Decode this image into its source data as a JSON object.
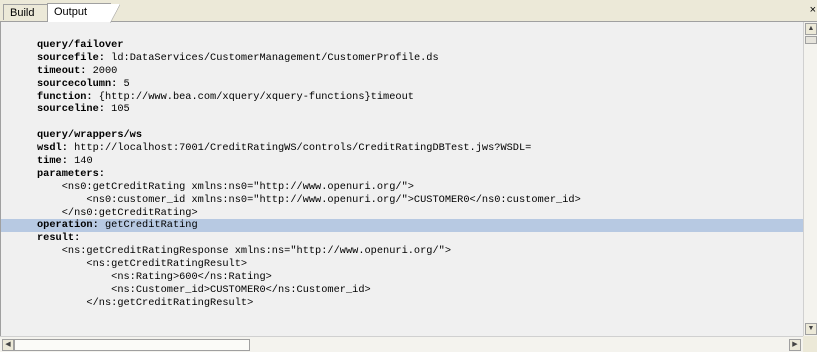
{
  "tabs": [
    {
      "label": "Build",
      "active": false
    },
    {
      "label": "Output",
      "active": true
    }
  ],
  "close_label": "×",
  "output": {
    "lines": [
      {
        "key": "query/failover",
        "value": ""
      },
      {
        "key": "sourcefile:",
        "value": " ld:DataServices/CustomerManagement/CustomerProfile.ds"
      },
      {
        "key": "timeout:",
        "value": " 2000"
      },
      {
        "key": "sourcecolumn:",
        "value": " 5"
      },
      {
        "key": "function:",
        "value": " {http://www.bea.com/xquery/xquery-functions}timeout"
      },
      {
        "key": "sourceline:",
        "value": " 105"
      },
      {
        "key": "",
        "value": ""
      },
      {
        "key": "query/wrappers/ws",
        "value": ""
      },
      {
        "key": "wsdl:",
        "value": " http://localhost:7001/CreditRatingWS/controls/CreditRatingDBTest.jws?WSDL="
      },
      {
        "key": "time:",
        "value": " 140"
      },
      {
        "key": "parameters:",
        "value": ""
      },
      {
        "key": "",
        "value": "    <ns0:getCreditRating xmlns:ns0=\"http://www.openuri.org/\">"
      },
      {
        "key": "",
        "value": "        <ns0:customer_id xmlns:ns0=\"http://www.openuri.org/\">CUSTOMER0</ns0:customer_id>"
      },
      {
        "key": "",
        "value": "    </ns0:getCreditRating>"
      },
      {
        "key": "operation:",
        "value": " getCreditRating",
        "highlight": true
      },
      {
        "key": "result:",
        "value": ""
      },
      {
        "key": "",
        "value": "    <ns:getCreditRatingResponse xmlns:ns=\"http://www.openuri.org/\">"
      },
      {
        "key": "",
        "value": "        <ns:getCreditRatingResult>"
      },
      {
        "key": "",
        "value": "            <ns:Rating>600</ns:Rating>"
      },
      {
        "key": "",
        "value": "            <ns:Customer_id>CUSTOMER0</ns:Customer_id>"
      },
      {
        "key": "",
        "value": "        </ns:getCreditRatingResult>"
      }
    ]
  }
}
